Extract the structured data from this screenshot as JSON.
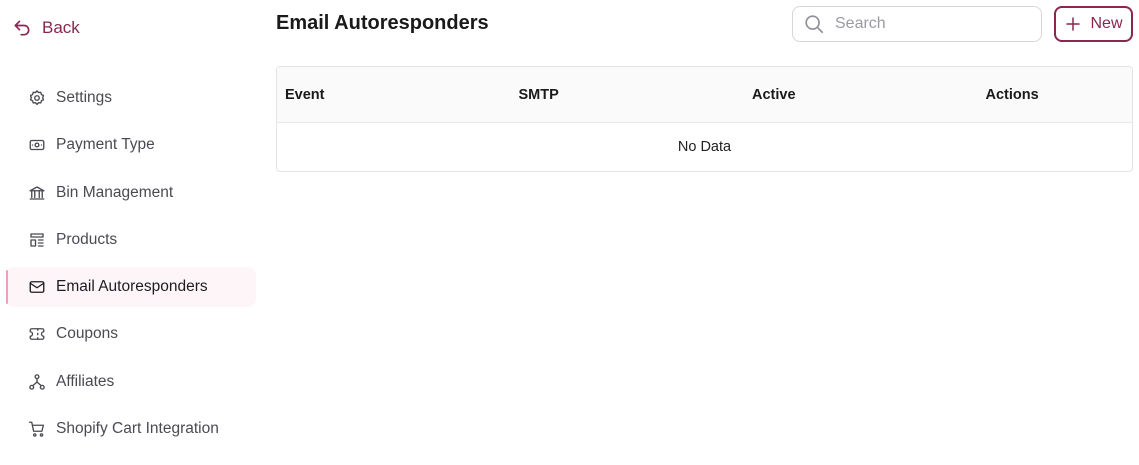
{
  "back": {
    "label": "Back"
  },
  "sidebar": {
    "items": [
      {
        "label": "Settings",
        "icon": "gear-icon"
      },
      {
        "label": "Payment Type",
        "icon": "banknote-icon"
      },
      {
        "label": "Bin Management",
        "icon": "bank-icon"
      },
      {
        "label": "Products",
        "icon": "layout-icon"
      },
      {
        "label": "Email Autoresponders",
        "icon": "mail-icon",
        "active": true
      },
      {
        "label": "Coupons",
        "icon": "ticket-icon"
      },
      {
        "label": "Affiliates",
        "icon": "network-icon"
      },
      {
        "label": "Shopify Cart Integration",
        "icon": "cart-icon"
      }
    ]
  },
  "page": {
    "title": "Email Autoresponders"
  },
  "search": {
    "placeholder": "Search",
    "value": ""
  },
  "toolbar": {
    "new_label": "New"
  },
  "table": {
    "columns": [
      "Event",
      "SMTP",
      "Active",
      "Actions"
    ],
    "rows": [],
    "empty_text": "No Data"
  },
  "colors": {
    "accent": "#8a2650",
    "active_bg": "#fdf5f7",
    "active_bar": "#e9a2b9"
  }
}
